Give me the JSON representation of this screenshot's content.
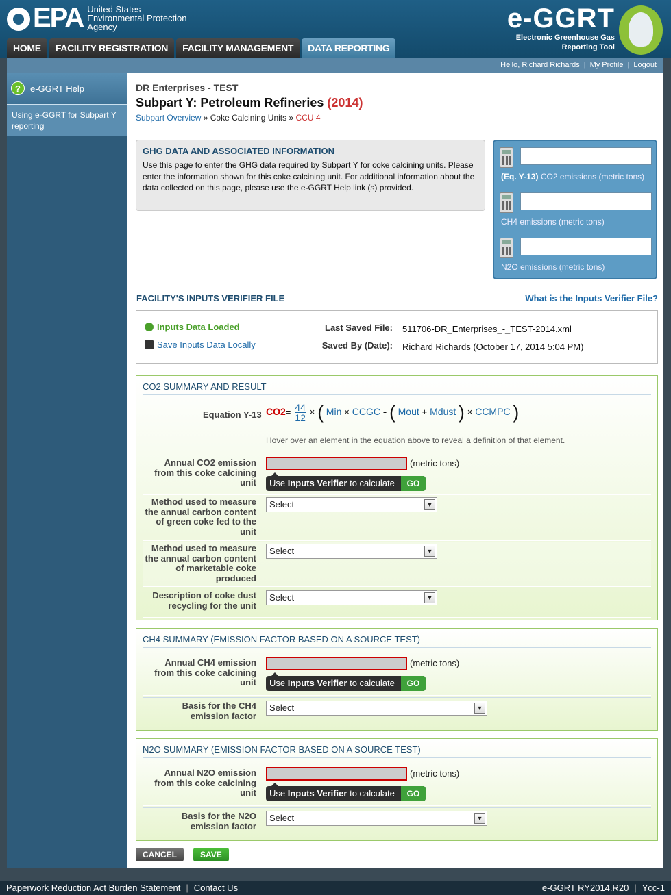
{
  "header": {
    "epa_mark": "EPA",
    "epa_line1": "United States",
    "epa_line2": "Environmental Protection",
    "epa_line3": "Agency",
    "app_logo": "e-GGRT",
    "app_sub1": "Electronic Greenhouse Gas",
    "app_sub2": "Reporting Tool"
  },
  "nav": {
    "tabs": [
      {
        "label": "HOME"
      },
      {
        "label": "FACILITY REGISTRATION"
      },
      {
        "label": "FACILITY MANAGEMENT"
      },
      {
        "label": "DATA REPORTING"
      }
    ],
    "active": "DATA REPORTING"
  },
  "userbar": {
    "greeting": "Hello, Richard Richards",
    "profile": "My Profile",
    "logout": "Logout"
  },
  "sidebar": {
    "help_title": "e-GGRT Help",
    "help_link": "Using e-GGRT for Subpart Y reporting"
  },
  "page": {
    "facility": "DR Enterprises - TEST",
    "title": "Subpart Y: Petroleum Refineries",
    "year": "(2014)",
    "breadcrumb": {
      "overview": "Subpart Overview",
      "sep": "»",
      "units": "Coke Calcining Units",
      "current": "CCU 4"
    }
  },
  "ghg_info": {
    "heading": "GHG DATA AND ASSOCIATED INFORMATION",
    "body": "Use this page to enter the GHG data required by Subpart Y for coke calcining units. Please enter the information shown for this coke calcining unit. For additional information about the data collected on this page, please use the e-GGRT Help link (s) provided."
  },
  "calc_panel": {
    "co2_eq": "(Eq. Y-13)",
    "co2_label": "CO2 emissions (metric tons)",
    "ch4_label": "CH4 emissions (metric tons)",
    "n2o_label": "N2O emissions (metric tons)",
    "co2_value": "",
    "ch4_value": "",
    "n2o_value": ""
  },
  "verifier": {
    "title": "FACILITY'S INPUTS VERIFIER FILE",
    "help_link": "What is the Inputs Verifier File?",
    "loaded": "Inputs Data Loaded",
    "save_local": "Save Inputs Data Locally",
    "last_saved_label": "Last Saved File:",
    "last_saved_value": "511706-DR_Enterprises_-_TEST-2014.xml",
    "saved_by_label": "Saved By (Date):",
    "saved_by_value": "Richard Richards (October 17, 2014 5:04 PM)"
  },
  "co2_section": {
    "heading": "CO2 SUMMARY AND RESULT",
    "eq_label": "Equation Y-13",
    "eq": {
      "lhs": "CO2",
      "eq": "=",
      "num": "44",
      "den": "12",
      "times": "×",
      "min": "Min",
      "ccgc": "CCGC",
      "minus": "-",
      "mout": "Mout",
      "plus": "+",
      "mdust": "Mdust",
      "ccmpc": "CCMPC"
    },
    "hover_note": "Hover over an element in the equation above to reveal a definition of that element.",
    "annual_label": "Annual CO2 emission from this coke calcining unit",
    "annual_value": "",
    "units": "(metric tons)",
    "method_green_label": "Method used to measure the annual carbon content of green coke fed to the unit",
    "method_market_label": "Method used to measure the annual carbon content of marketable coke produced",
    "dust_label": "Description of coke dust recycling for the unit",
    "select_default": "Select"
  },
  "verifier_button": {
    "pre": "Use",
    "bold": "Inputs Verifier",
    "post": "to calculate",
    "go": "GO"
  },
  "ch4_section": {
    "heading": "CH4 SUMMARY (EMISSION FACTOR BASED ON A SOURCE TEST)",
    "annual_label": "Annual CH4 emission from this coke calcining unit",
    "annual_value": "",
    "units": "(metric tons)",
    "basis_label": "Basis for the CH4 emission factor",
    "select_default": "Select"
  },
  "n2o_section": {
    "heading": "N2O SUMMARY (EMISSION FACTOR BASED ON A SOURCE TEST)",
    "annual_label": "Annual N2O emission from this coke calcining unit",
    "annual_value": "",
    "units": "(metric tons)",
    "basis_label": "Basis for the N2O emission factor",
    "select_default": "Select"
  },
  "buttons": {
    "cancel": "CANCEL",
    "save": "SAVE"
  },
  "footer": {
    "paperwork": "Paperwork Reduction Act Burden Statement",
    "contact": "Contact Us",
    "version": "e-GGRT RY2014.R20",
    "page_id": "Ycc-1"
  }
}
